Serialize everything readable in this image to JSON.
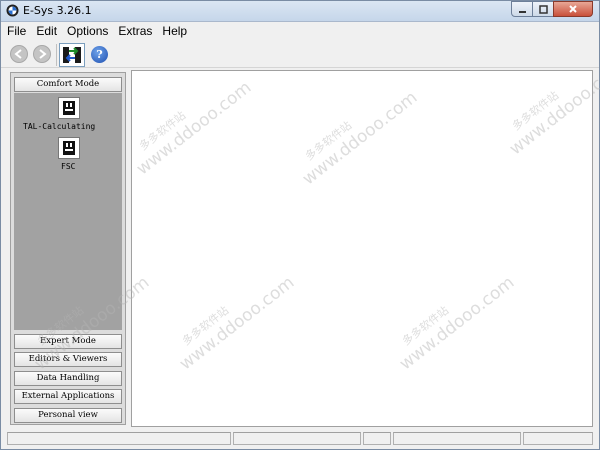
{
  "window": {
    "title": "E-Sys 3.26.1"
  },
  "menu": [
    "File",
    "Edit",
    "Options",
    "Extras",
    "Help"
  ],
  "toolbar": {
    "back_icon": "back-arrow-icon",
    "forward_icon": "forward-arrow-icon",
    "connect_icon": "connection-icon",
    "help_glyph": "?"
  },
  "sidebar": {
    "comfort_mode": "Comfort Mode",
    "tools": [
      {
        "label": "TAL-Calculating"
      },
      {
        "label": "FSC"
      }
    ],
    "buttons": [
      "Expert Mode",
      "Editors & Viewers",
      "Data Handling",
      "External Applications",
      "Personal view"
    ]
  },
  "watermark": {
    "cn": "多多软件站",
    "url": "www.ddooo.com"
  },
  "colors": {
    "panel_gray": "#a2a2a2",
    "title_bar": "#c5d6ea",
    "close_button": "#c9503a",
    "help_blue": "#1e4fb0"
  }
}
